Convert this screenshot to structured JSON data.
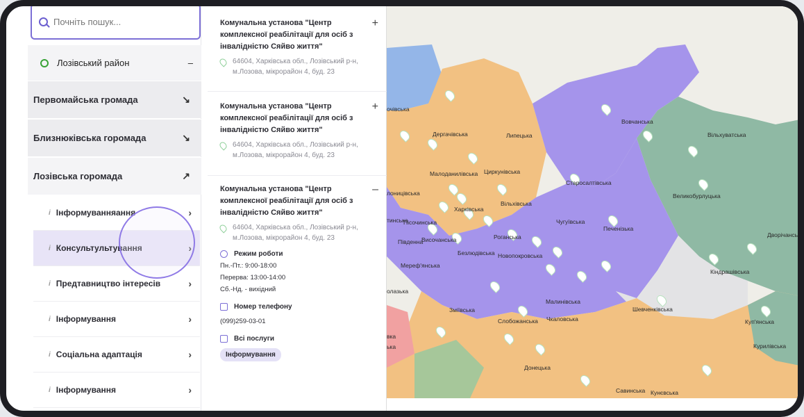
{
  "search": {
    "placeholder": "Почніть пошук..."
  },
  "district": {
    "label": "Лозівський район",
    "toggle": "–"
  },
  "hromadas": [
    {
      "label": "Первомайська громада",
      "arrow": "↘"
    },
    {
      "label": "Близнюківська горомада",
      "arrow": "↘"
    },
    {
      "label": "Лозівська горомада",
      "arrow": "↗"
    }
  ],
  "services": [
    {
      "label": "Інформуванняання",
      "chev": "›"
    },
    {
      "label": "Консультультування",
      "chev": "›"
    },
    {
      "label": "Предтавництво інтересів",
      "chev": "›"
    },
    {
      "label": "Інформування",
      "chev": "›"
    },
    {
      "label": "Соціальна адаптація",
      "chev": "›"
    },
    {
      "label": "Інформування",
      "chev": "›"
    }
  ],
  "info_marker": "i",
  "cards": [
    {
      "title": "Комунальна установа \"Центр комплексної реабілітації для осіб з інвалідністю Сяйво життя\"",
      "address": "64604, Харківська обл., Лозівський р-н, м.Лозова, мікрорайон 4, буд. 23",
      "toggle": "+"
    },
    {
      "title": "Комунальна установа \"Центр комплексної реабілітації для осіб з інвалідністю Сяйво життя\"",
      "address": "64604, Харківська обл., Лозівський р-н, м.Лозова, мікрорайон 4, буд. 23",
      "toggle": "+"
    },
    {
      "title": "Комунальна установа \"Центр комплексної реабілітації для осіб з інвалідністю Сяйво життя\"",
      "address": "64604, Харківська обл., Лозівський р-н, м.Лозова, мікрорайон 4, буд. 23",
      "toggle": "–"
    }
  ],
  "details": {
    "hours_label": "Режим роботи",
    "hours": [
      "Пн.-Пт.: 9:00-18:00",
      "Перерва: 13:00-14:00",
      "Сб.-Нд. - вихідний"
    ],
    "phone_label": "Номер телефону",
    "phone": "(099)259-03-01",
    "services_label": "Всі послуги",
    "service_tag": "Інформування"
  },
  "map_labels": [
    "Вовчанська",
    "Вільхуватська",
    "Дергачівська",
    "Липецька",
    "Малоданилівська",
    "Циркунівська",
    "Старосалтівська",
    "Великобурлуцька",
    "Харківська",
    "Вільхівська",
    "Чугуївська",
    "Печенізька",
    "Дворічанська",
    "Пісочинська",
    "Височанська",
    "Роганська",
    "Південна",
    "Безлюдівська",
    "Новопокровська",
    "Мереф'янська",
    "Малинівська",
    "Кіндрашівська",
    "Зміївська",
    "Чкаловська",
    "Шевченківська",
    "Слобожанська",
    "Куп'янська",
    "Курилівська",
    "Донецька",
    "Савинська",
    "Кунєвська",
    "очівська",
    "лоницівська",
    "тинська",
    "олазька",
    "вка",
    "ька"
  ],
  "colors": {
    "accent": "#7c6fd6",
    "purple": "#a594eb",
    "orange": "#f2c182",
    "teal": "#8fb9a4",
    "blue": "#94b6e8",
    "green": "#a6c79a",
    "pink": "#f1a1a1",
    "gray": "#e3e3e5"
  }
}
